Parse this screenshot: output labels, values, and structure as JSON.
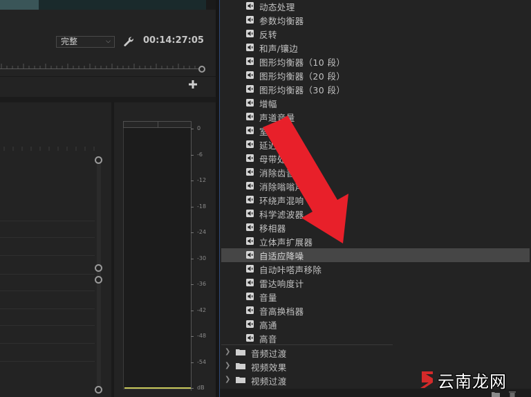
{
  "monitor": {
    "quality": {
      "selected": "完整"
    },
    "timecode": "00:14:27:05"
  },
  "meter": {
    "db_labels": [
      "0",
      "-6",
      "-12",
      "-18",
      "-24",
      "-30",
      "-36",
      "-42",
      "-48",
      "-54",
      "dB"
    ]
  },
  "effects_panel": {
    "audio_effects": [
      "动态处理",
      "参数均衡器",
      "反转",
      "和声/镶边",
      "图形均衡器（10 段）",
      "图形均衡器（20 段）",
      "图形均衡器（30 段）",
      "增幅",
      "声道音量",
      "室内混响",
      "延迟",
      "母带处理",
      "消除齿音",
      "消除嗡嗡声",
      "环绕声混响",
      "科学滤波器",
      "移相器",
      "立体声扩展器",
      "自适应降噪",
      "自动咔嗒声移除",
      "雷达响度计",
      "音量",
      "音高换档器",
      "高通",
      "高音"
    ],
    "selected_effect": "自适应降噪",
    "bins": [
      "音频过渡",
      "视频效果",
      "视频过渡"
    ]
  },
  "annotation": {
    "arrow_color": "#e8202a"
  },
  "watermark": {
    "text": "云南龙网",
    "logo_color": "#d42a2a"
  }
}
